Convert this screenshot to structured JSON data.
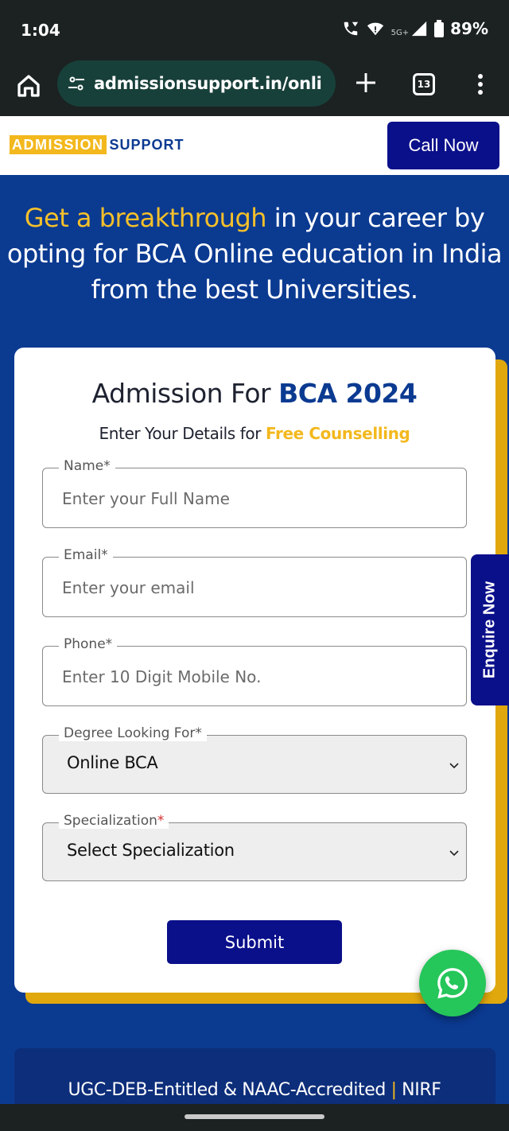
{
  "status_bar": {
    "time": "1:04",
    "network": "5G+",
    "battery": "89%"
  },
  "browser": {
    "url": "admissionsupport.in/onli",
    "tab_count": "13"
  },
  "site_header": {
    "logo_part1": "ADMISSION",
    "logo_part2": "SUPPORT",
    "call_now_label": "Call Now"
  },
  "hero": {
    "highlight": "Get a breakthrough",
    "text": "in your career by opting for BCA Online education in India from the best Universities."
  },
  "form": {
    "title_prefix": "Admission For",
    "title_bold": "BCA 2024",
    "subtitle_prefix": "Enter Your Details for",
    "subtitle_highlight": "Free Counselling",
    "fields": [
      {
        "label": "Name*",
        "placeholder": "Enter your Full Name"
      },
      {
        "label": "Email*",
        "placeholder": "Enter your email"
      },
      {
        "label": "Phone*",
        "placeholder": "Enter 10 Digit Mobile No."
      }
    ],
    "degree": {
      "label": "Degree Looking For*",
      "value": "Online BCA"
    },
    "specialization": {
      "label": "Specialization",
      "required_mark": "*",
      "value": "Select Specialization"
    },
    "submit_label": "Submit"
  },
  "enquire_label": "Enquire Now",
  "bottom": {
    "text": "UGC-DEB-Entitled & NAAC-Accredited",
    "separator": "|",
    "suffix": "NIRF"
  },
  "colors": {
    "brand_blue": "#0b3a91",
    "button_navy": "#0a0f8a",
    "accent_yellow": "#f3b81d",
    "whatsapp_green": "#25c65a"
  },
  "icons": [
    "home-icon",
    "tune-icon",
    "plus-icon",
    "tabs-icon",
    "more-vert-icon",
    "chevron-down-icon",
    "whatsapp-icon"
  ]
}
